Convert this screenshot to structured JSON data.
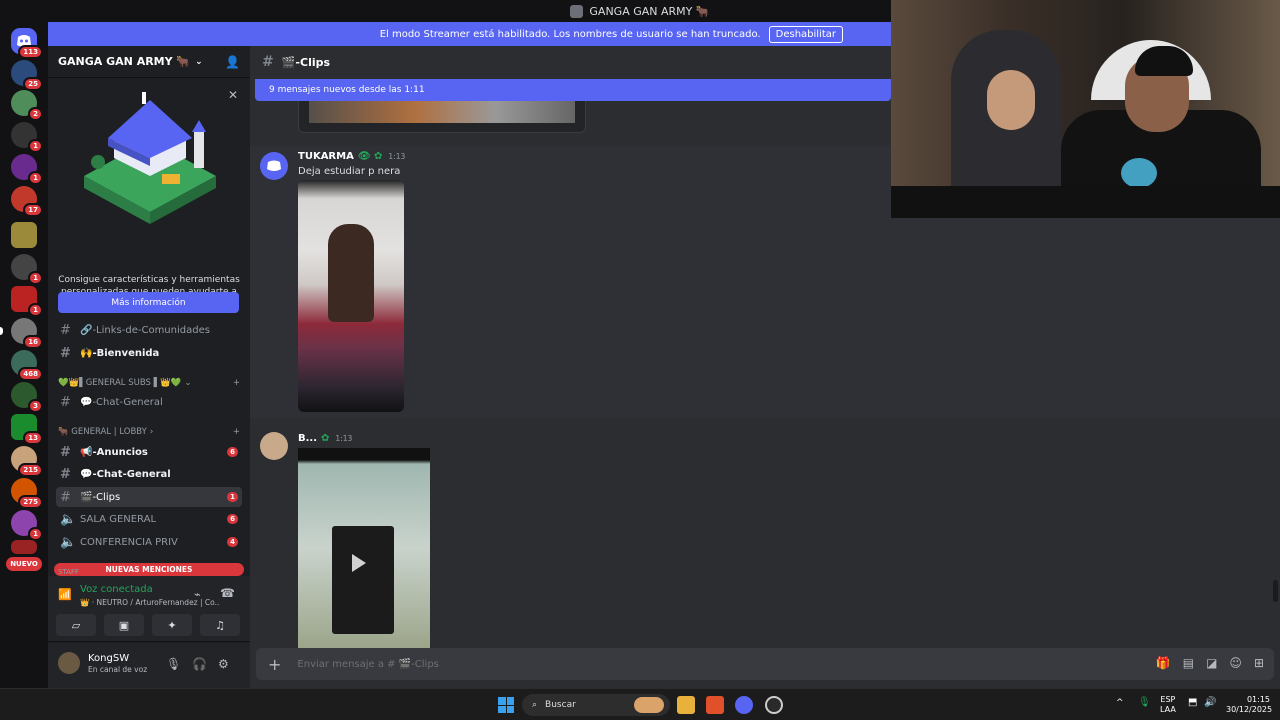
{
  "window": {
    "title": "GANGA GAN ARMY 🐂"
  },
  "banner": {
    "text": "El modo Streamer está habilitado. Los nombres de usuario se han truncado.",
    "button": "Deshabilitar"
  },
  "servers": {
    "badges": [
      "113",
      "25",
      "2",
      "1",
      "1",
      "17",
      "1",
      "1",
      "16",
      "468",
      "3",
      "13",
      "215",
      "275",
      "1"
    ],
    "new_label": "NUEVO"
  },
  "guild": {
    "name": "GANGA GAN ARMY 🐂",
    "promo_text": "Consigue características y herramientas personalizadas que pueden ayudarte a dirigir tu comunidad.",
    "promo_button": "Más información"
  },
  "channels": {
    "links": "🔗-Links-de-Comunidades",
    "bienvenida": "🙌-Bienvenida",
    "cat_subs": "💚👑▌GENERAL SUBS ▌👑💚",
    "chat_subs": "💬-Chat-General",
    "cat_general": "🐂 GENERAL | LOBBY",
    "anuncios": "📢-Anuncios",
    "anuncios_count": "6",
    "chat_general": "💬-Chat-General",
    "clips": "🎬-Clips",
    "clips_count": "1",
    "sala": "SALA GENERAL",
    "sala_count": "6",
    "conferencia": "CONFERENCIA PRIV",
    "conferencia_count": "4",
    "staff": "STAFF",
    "new_mentions": "NUEVAS MENCIONES"
  },
  "voice": {
    "title": "Voz conectada",
    "sub": "👑 · NEUTRO / ArturoFernandez | Co..."
  },
  "user": {
    "name": "KongSW",
    "status": "En canal de voz"
  },
  "main": {
    "channel": "🎬-Clips",
    "new_messages": "9 mensajes nuevos desde las 1:11",
    "msg1": {
      "author": "TUKARMA",
      "time": "1:13",
      "text": "Deja estudiar p nera"
    },
    "msg2": {
      "author": "B...",
      "time": "1:13"
    },
    "composer_placeholder": "Enviar mensaje a # 🎬-Clips"
  },
  "taskbar": {
    "search": "Buscar",
    "lang": "ESP",
    "lang2": "LAA",
    "time": "01:15",
    "date": "30/12/2025"
  },
  "colors": {
    "blurple": "#5865f2",
    "red": "#da373c",
    "green": "#23a55a"
  }
}
